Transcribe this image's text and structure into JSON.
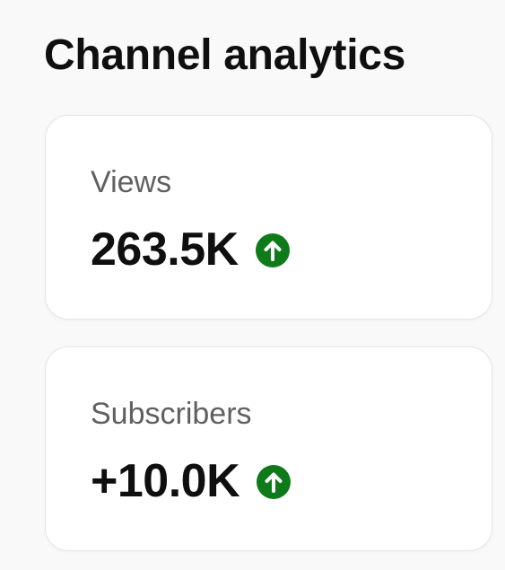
{
  "header": {
    "title": "Channel analytics"
  },
  "cards": [
    {
      "label": "Views",
      "value": "263.5K",
      "trend": "up",
      "trend_icon": "arrow-up-circle-icon"
    },
    {
      "label": "Subscribers",
      "value": "+10.0K",
      "trend": "up",
      "trend_icon": "arrow-up-circle-icon"
    }
  ],
  "colors": {
    "background": "#f9f9f9",
    "card_background": "#ffffff",
    "text_primary": "#0f0f0f",
    "text_secondary": "#606060",
    "trend_up": "#0f7a1a"
  }
}
